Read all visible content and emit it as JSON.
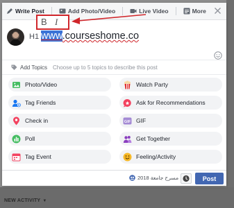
{
  "tabs": [
    {
      "label": "Write Post",
      "icon": "pencil-icon"
    },
    {
      "label": "Add Photo/Video",
      "icon": "photo-icon"
    },
    {
      "label": "Live Video",
      "icon": "video-camera-icon"
    },
    {
      "label": "More",
      "icon": "more-icon"
    }
  ],
  "format_toolbar": {
    "bold": "B",
    "italic": "I"
  },
  "editor": {
    "heading_tag": "H1",
    "text_selected": "www",
    "text_rest": ".courseshome.co"
  },
  "topics": {
    "label": "Add Topics",
    "hint": "Choose up to 5 topics to describe this post"
  },
  "options_left": [
    {
      "label": "Photo/Video",
      "icon": "photo-icon",
      "color": "#45bd62"
    },
    {
      "label": "Tag Friends",
      "icon": "tag-friends-icon",
      "color": "#1877f2"
    },
    {
      "label": "Check in",
      "icon": "location-pin-icon",
      "color": "#f3425f"
    },
    {
      "label": "Poll",
      "icon": "poll-icon",
      "color": "#45bd62"
    },
    {
      "label": "Tag Event",
      "icon": "calendar-icon",
      "color": "#f3425f"
    }
  ],
  "options_right": [
    {
      "label": "Watch Party",
      "icon": "popcorn-icon",
      "color": "#e02f2f"
    },
    {
      "label": "Ask for Recommendations",
      "icon": "recommend-icon",
      "color": "#f3425f"
    },
    {
      "label": "GIF",
      "icon": "gif-icon",
      "color": "#a389d4"
    },
    {
      "label": "Get Together",
      "icon": "get-together-icon",
      "color": "#8b3fbf"
    },
    {
      "label": "Feeling/Activity",
      "icon": "smiley-icon",
      "color": "#f7b928"
    }
  ],
  "footer": {
    "audience": "مسرح جامعة 2018",
    "post_label": "Post"
  },
  "background": {
    "new_activity": "NEW ACTIVITY"
  },
  "colors": {
    "accent": "#4267b2",
    "annotation_red": "#d0262b"
  }
}
